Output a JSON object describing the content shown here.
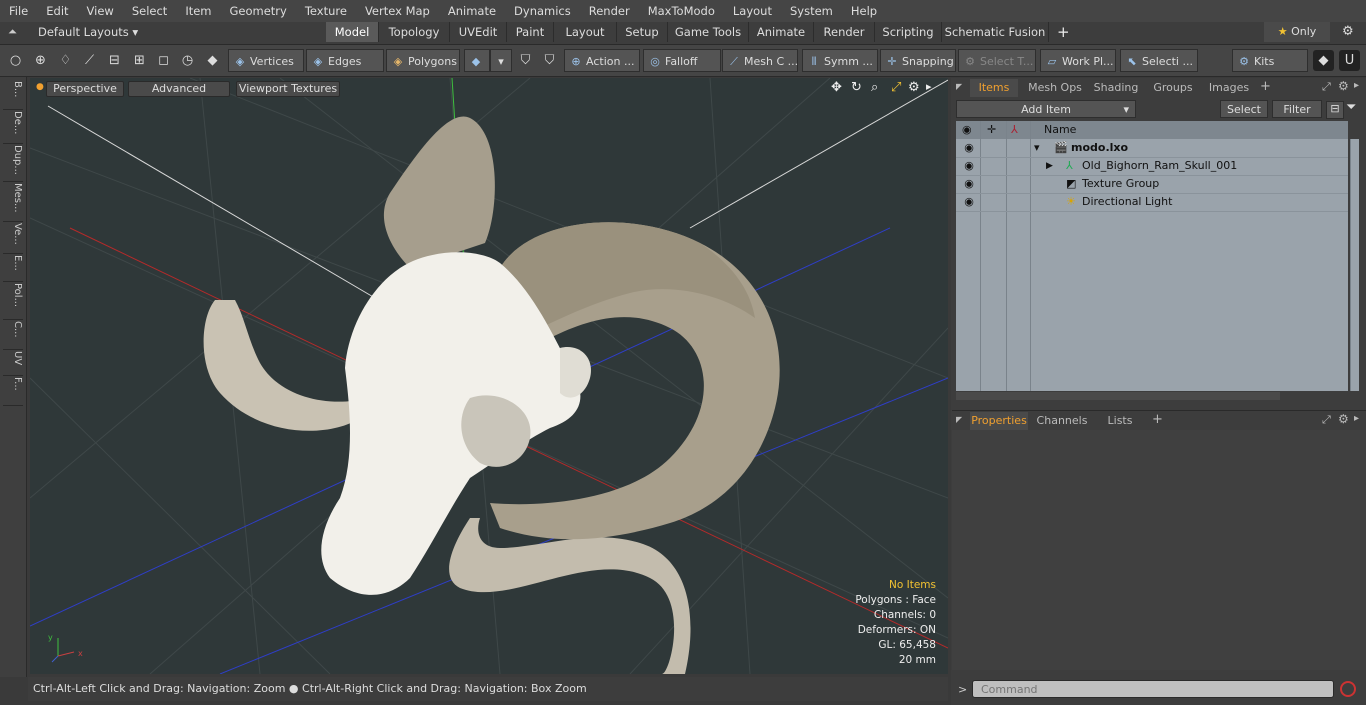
{
  "menu": [
    "File",
    "Edit",
    "View",
    "Select",
    "Item",
    "Geometry",
    "Texture",
    "Vertex Map",
    "Animate",
    "Dynamics",
    "Render",
    "MaxToModo",
    "Layout",
    "System",
    "Help"
  ],
  "layout_selector": "Default Layouts",
  "layout_tabs": [
    "Model",
    "Topology",
    "UVEdit",
    "Paint",
    "Layout",
    "Setup",
    "Game Tools",
    "Animate",
    "Render",
    "Scripting",
    "Schematic Fusion"
  ],
  "only_label": "Only",
  "toolbar": {
    "vertices": "Vertices",
    "edges": "Edges",
    "polygons": "Polygons",
    "action": "Action ...",
    "falloff": "Falloff",
    "mesh": "Mesh C ...",
    "symmetry": "Symm ...",
    "snapping": "Snapping",
    "select_t": "Select T...",
    "work_plane": "Work Pl...",
    "selection": "Selecti ...",
    "kits": "Kits"
  },
  "left_tabs": [
    "B...",
    "De...",
    "Dup...",
    "Mes...",
    "Ve...",
    "E...",
    "Pol...",
    "C...",
    "UV",
    "F..."
  ],
  "viewport": {
    "perspective": "Perspective",
    "advanced": "Advanced",
    "textures": "Viewport Textures"
  },
  "stats": {
    "items": "No Items",
    "polygons": "Polygons : Face",
    "channels": "Channels: 0",
    "deformers": "Deformers: ON",
    "gl": "GL: 65,458",
    "scale": "20 mm"
  },
  "status": {
    "left": "Ctrl-Alt-Left Click and Drag: Navigation: Zoom",
    "right": "Ctrl-Alt-Right Click and Drag: Navigation: Box Zoom"
  },
  "items_panel": {
    "tabs": [
      "Items",
      "Mesh Ops",
      "Shading",
      "Groups",
      "Images"
    ],
    "add_item": "Add Item",
    "select": "Select",
    "filter": "Filter",
    "col_name": "Name",
    "rows": [
      "modo.lxo",
      "Old_Bighorn_Ram_Skull_001",
      "Texture Group",
      "Directional Light"
    ]
  },
  "props_panel": {
    "tabs": [
      "Properties",
      "Channels",
      "Lists"
    ]
  },
  "command_placeholder": "Command",
  "colors": {
    "accent": "#f0a030",
    "bone": "#f2f0ea",
    "horn": "#b3ab9c",
    "viewport_bg": "#2f3839"
  }
}
